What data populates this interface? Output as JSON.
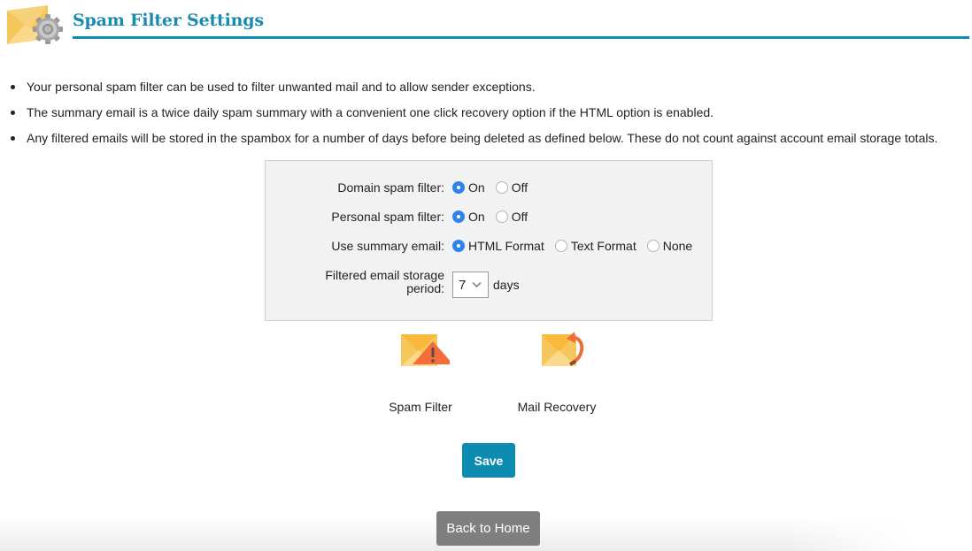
{
  "header": {
    "title": "Spam Filter Settings",
    "icon": "envelope-gear-icon",
    "accent_color": "#0e8bb0"
  },
  "intro": {
    "bullets": [
      "Your personal spam filter can be used to filter unwanted mail and to allow sender exceptions.",
      "The summary email is a twice daily spam summary with a convenient one click recovery option if the HTML option is enabled.",
      "Any filtered emails will be stored in the spambox for a number of days before being deleted as defined below. These do not count against account email storage totals."
    ]
  },
  "form": {
    "domain_filter": {
      "label": "Domain spam filter:",
      "options": [
        {
          "label": "On",
          "checked": true
        },
        {
          "label": "Off",
          "checked": false
        }
      ]
    },
    "personal_filter": {
      "label": "Personal spam filter:",
      "options": [
        {
          "label": "On",
          "checked": true
        },
        {
          "label": "Off",
          "checked": false
        }
      ]
    },
    "summary_email": {
      "label": "Use summary email:",
      "options": [
        {
          "label": "HTML Format",
          "checked": true
        },
        {
          "label": "Text Format",
          "checked": false
        },
        {
          "label": "None",
          "checked": false
        }
      ]
    },
    "storage_period": {
      "label_line1": "Filtered email storage",
      "label_line2": "period:",
      "value": "7",
      "unit": "days"
    },
    "radio_checked_color": "#2f84e9"
  },
  "features": [
    {
      "label": "Spam Filter",
      "icon": "envelope-warning-icon"
    },
    {
      "label": "Mail Recovery",
      "icon": "envelope-recovery-icon"
    }
  ],
  "buttons": {
    "save": "Save",
    "back_home": "Back to Home"
  }
}
